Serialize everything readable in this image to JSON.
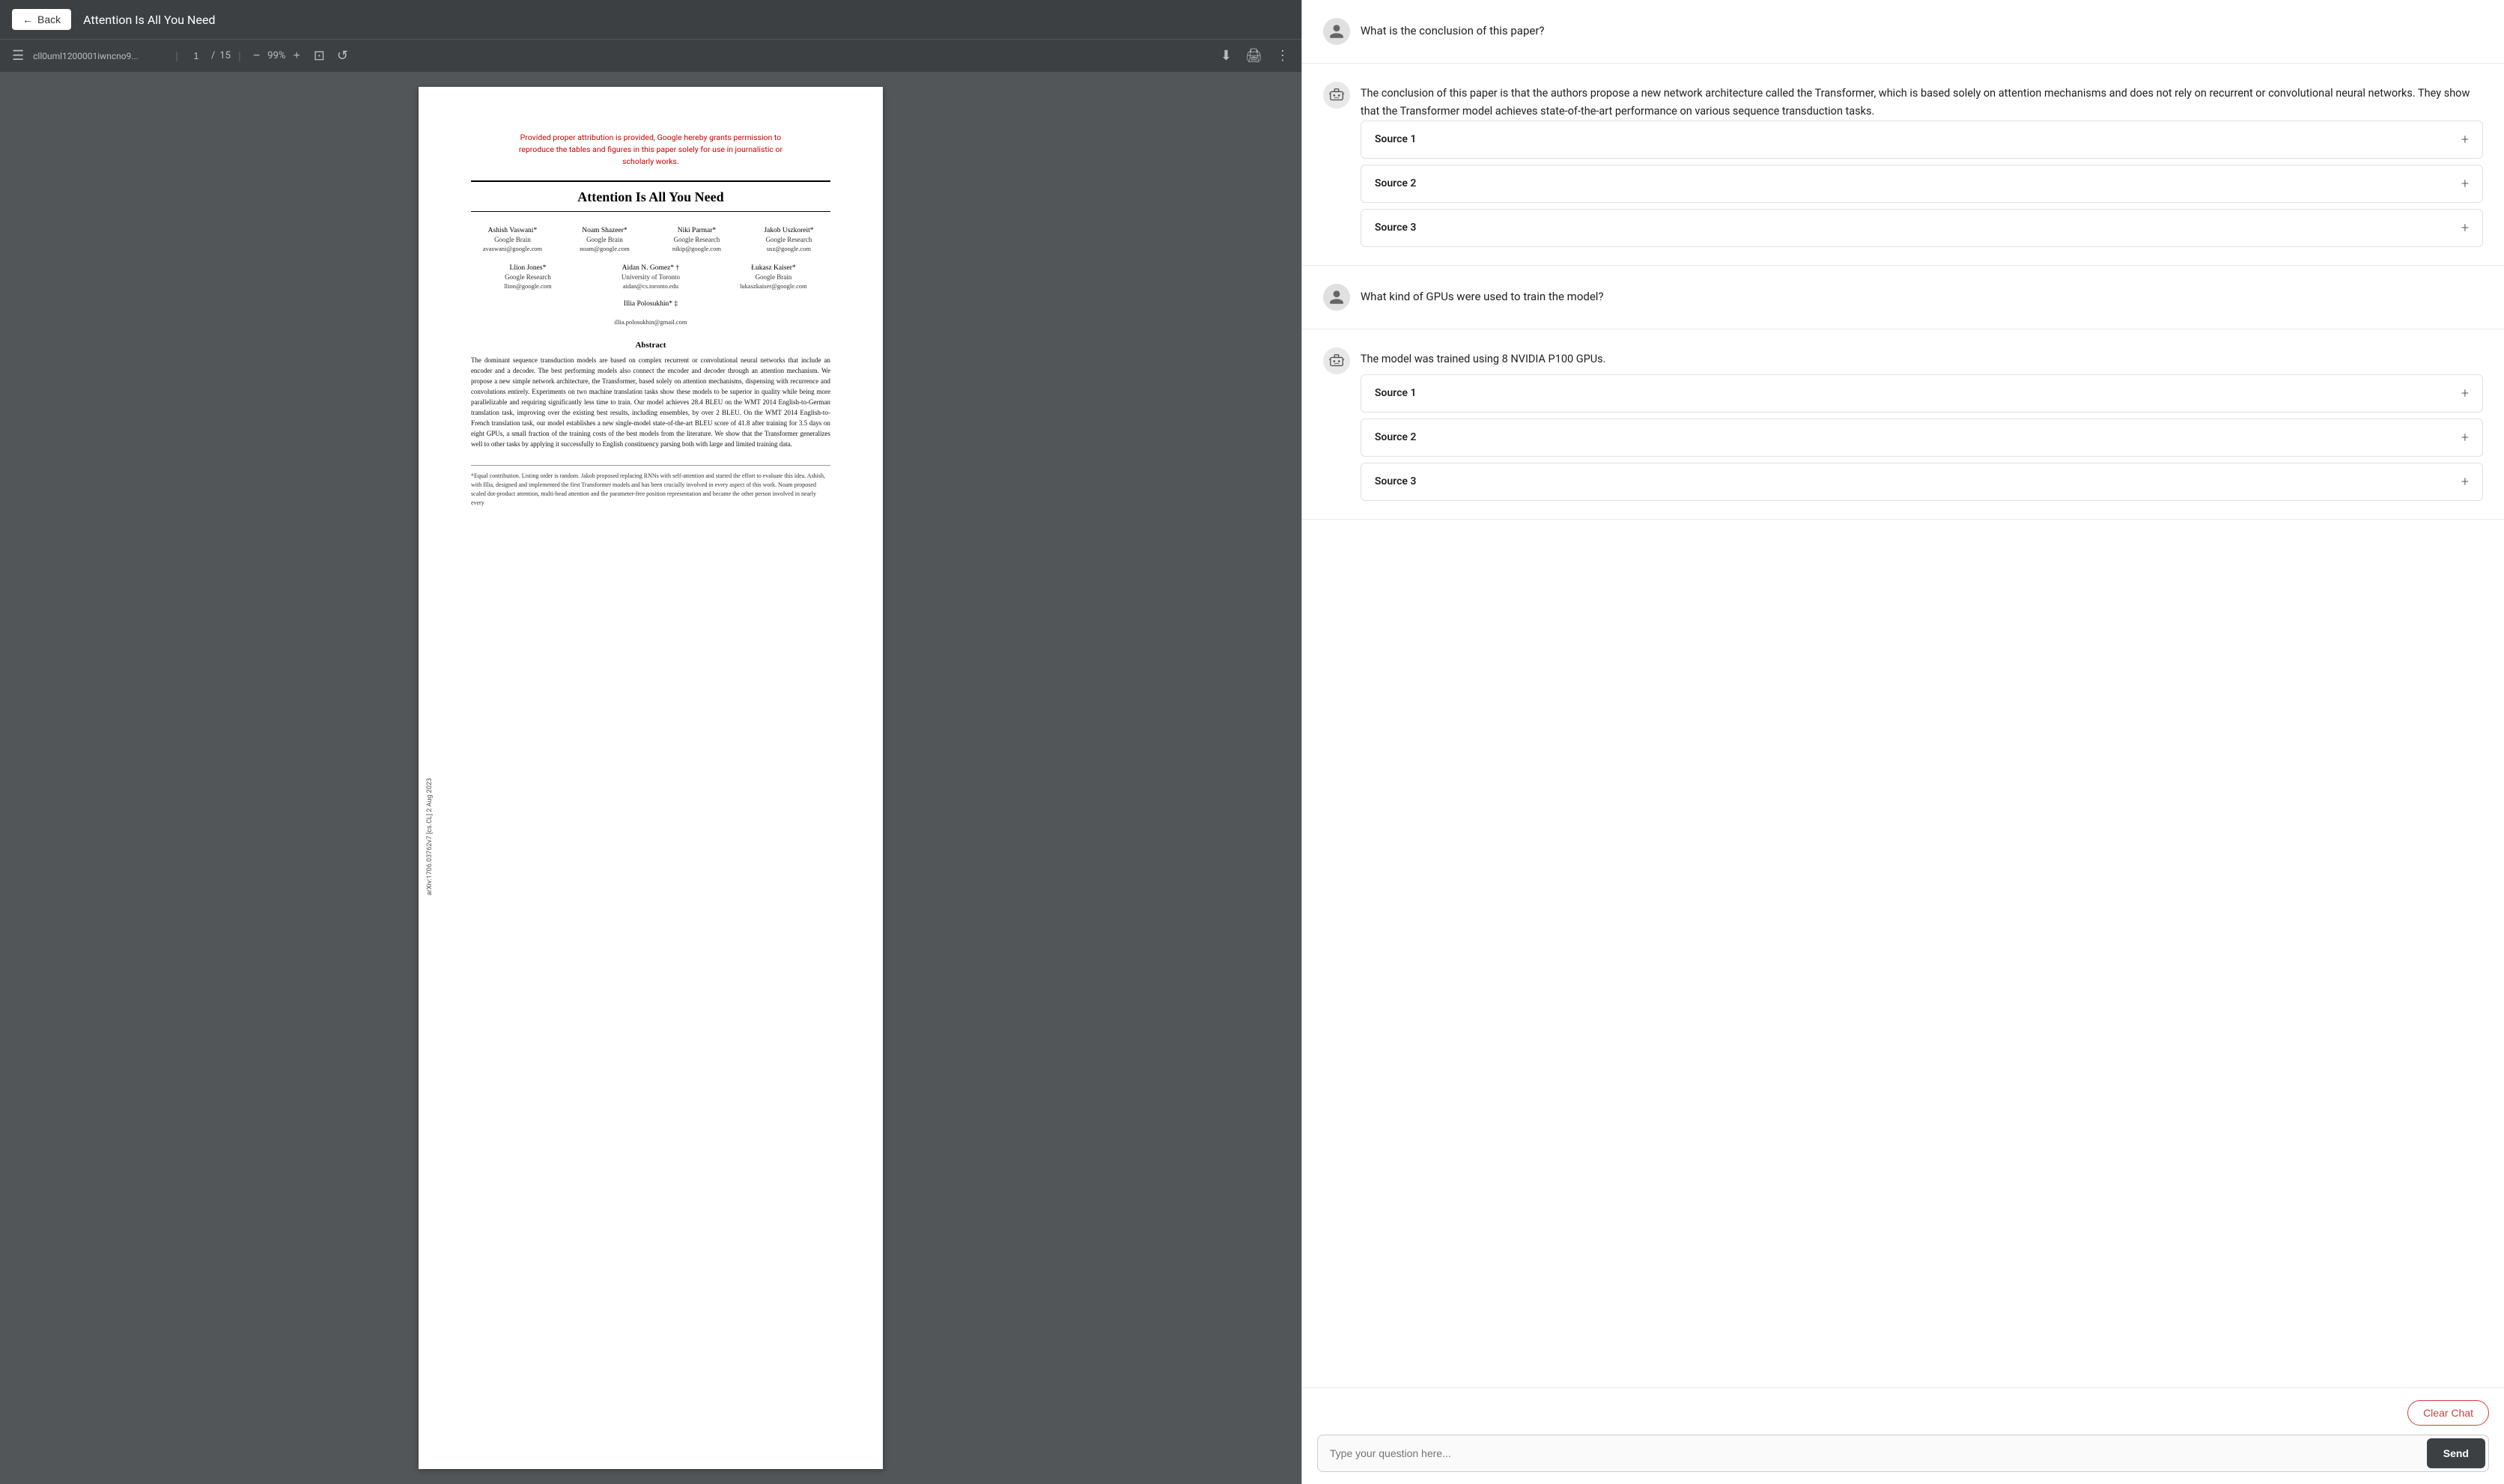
{
  "left": {
    "titlebar": {
      "back_label": "Back",
      "title": "Attention Is All You Need"
    },
    "toolbar": {
      "filename": "cll0uml1200001iwncno9...",
      "page_current": "1",
      "page_total": "15",
      "zoom": "99%"
    },
    "pdf": {
      "permission_notice": "Provided proper attribution is provided, Google hereby grants permission to\nreproduce the tables and figures in this paper solely for use in journalistic or\nscholarly works.",
      "paper_title": "Attention Is All You Need",
      "arxiv_watermark": "arXiv:1706.03762v7  [cs.CL]  2 Aug 2023",
      "authors_row1": [
        {
          "name": "Ashish Vaswani*",
          "org": "Google Brain",
          "email": "avaswani@google.com"
        },
        {
          "name": "Noam Shazeer*",
          "org": "Google Brain",
          "email": "noam@google.com"
        },
        {
          "name": "Niki Parmar*",
          "org": "Google Research",
          "email": "nikip@google.com"
        },
        {
          "name": "Jakob Uszkoreit*",
          "org": "Google Research",
          "email": "usz@google.com"
        }
      ],
      "authors_row2": [
        {
          "name": "Llion Jones*",
          "org": "Google Research",
          "email": "llion@google.com"
        },
        {
          "name": "Aidan N. Gomez* †",
          "org": "University of Toronto",
          "email": "aidan@cs.toronto.edu"
        },
        {
          "name": "Łukasz Kaiser*",
          "org": "Google Brain",
          "email": "lukaszkaiser@google.com"
        }
      ],
      "authors_row3": {
        "name": "Illia Polosukhin* ‡",
        "email": "illia.polosukhin@gmail.com"
      },
      "abstract_heading": "Abstract",
      "abstract_text": "The dominant sequence transduction models are based on complex recurrent or convolutional neural networks that include an encoder and a decoder.  The best performing models also connect the encoder and decoder through an attention mechanism.  We propose a new simple network architecture, the Transformer, based solely on attention mechanisms, dispensing with recurrence and convolutions entirely.  Experiments on two machine translation tasks show these models to be superior in quality while being more parallelizable and requiring significantly less time to train.  Our model achieves 28.4 BLEU on the WMT 2014 English-to-German translation task, improving over the existing best results, including ensembles, by over 2 BLEU. On the WMT 2014 English-to-French translation task, our model establishes a new single-model state-of-the-art BLEU score of 41.8 after training for 3.5 days on eight GPUs, a small fraction of the training costs of the best models from the literature. We show that the Transformer generalizes well to other tasks by applying it successfully to English constituency parsing both with large and limited training data.",
      "footnote": "*Equal contribution. Listing order is random. Jakob proposed replacing RNNs with self-attention and started the effort to evaluate this idea. Ashish, with Illia, designed and implemented the first Transformer models and has been crucially involved in every aspect of this work. Noam proposed scaled dot-product attention, multi-head attention and the parameter-free position representation and became the other person involved in nearly every"
    }
  },
  "right": {
    "messages": [
      {
        "role": "user",
        "text": "What is the conclusion of this paper?"
      },
      {
        "role": "ai",
        "text": "The conclusion of this paper is that the authors propose a new network architecture called the Transformer, which is based solely on attention mechanisms and does not rely on recurrent or convolutional neural networks. They show that the Transformer model achieves state-of-the-art performance on various sequence transduction tasks.",
        "sources": [
          "Source 1",
          "Source 2",
          "Source 3"
        ]
      },
      {
        "role": "user",
        "text": "What kind of GPUs were used to train the model?"
      },
      {
        "role": "ai",
        "text": "The model was trained using 8 NVIDIA P100 GPUs.",
        "sources": [
          "Source 1",
          "Source 2",
          "Source 3"
        ]
      }
    ],
    "footer": {
      "clear_chat_label": "Clear Chat",
      "input_placeholder": "Type your question here...",
      "send_label": "Send"
    }
  },
  "icons": {
    "back": "←",
    "menu": "☰",
    "zoom_in": "+",
    "zoom_out": "−",
    "fit_page": "⊡",
    "rotate": "↺",
    "download": "⬇",
    "print": "🖨",
    "more": "⋮",
    "user": "👤",
    "bot": "🤖",
    "plus": "+"
  }
}
